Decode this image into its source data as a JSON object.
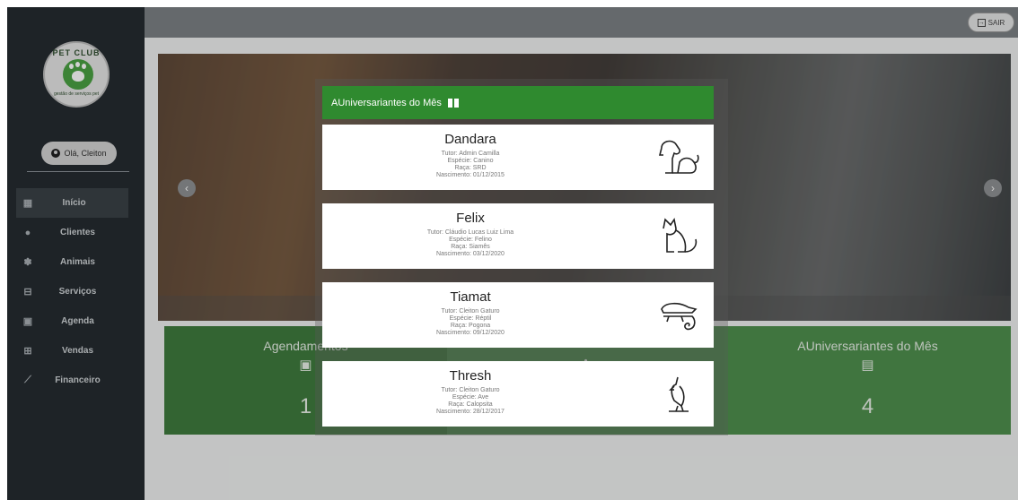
{
  "topbar": {
    "logout_label": "SAIR",
    "logout_icon": "logout-icon"
  },
  "sidebar": {
    "logo": {
      "brand": "PET CLUB",
      "subtitle": "gestão de serviços pet"
    },
    "user_greeting": "Olá, Cleiton",
    "items": [
      {
        "label": "Início",
        "icon": "dashboard-icon",
        "active": true
      },
      {
        "label": "Clientes",
        "icon": "user-icon"
      },
      {
        "label": "Animais",
        "icon": "paw-icon"
      },
      {
        "label": "Serviços",
        "icon": "briefcase-icon"
      },
      {
        "label": "Agenda",
        "icon": "calendar-icon"
      },
      {
        "label": "Vendas",
        "icon": "sales-icon"
      },
      {
        "label": "Financeiro",
        "icon": "chart-icon"
      }
    ]
  },
  "stats": [
    {
      "title": "Agendamentos",
      "value": "1"
    },
    {
      "title": "",
      "value": ""
    },
    {
      "title": "AUniversariantes do Mês",
      "value": "4"
    }
  ],
  "modal": {
    "title": "AUniversariantes do Mês",
    "pets": [
      {
        "name": "Dandara",
        "tutor": "Tutor: Admin Camilla",
        "especie": "Espécie: Canino",
        "raca": "Raça: SRD",
        "nascimento": "Nascimento: 01/12/2015",
        "icon": "dog-icon"
      },
      {
        "name": "Felix",
        "tutor": "Tutor: Cláudio Lucas Luiz Lima",
        "especie": "Espécie: Felino",
        "raca": "Raça: Siamês",
        "nascimento": "Nascimento: 03/12/2020",
        "icon": "cat-icon"
      },
      {
        "name": "Tiamat",
        "tutor": "Tutor: Cleiton Gaturo",
        "especie": "Espécie: Réptil",
        "raca": "Raça: Pogona",
        "nascimento": "Nascimento: 09/12/2020",
        "icon": "chameleon-icon"
      },
      {
        "name": "Thresh",
        "tutor": "Tutor: Cleiton Gaturo",
        "especie": "Espécie: Ave",
        "raca": "Raça: Calopsita",
        "nascimento": "Nascimento: 28/12/2017",
        "icon": "bird-icon"
      }
    ]
  }
}
